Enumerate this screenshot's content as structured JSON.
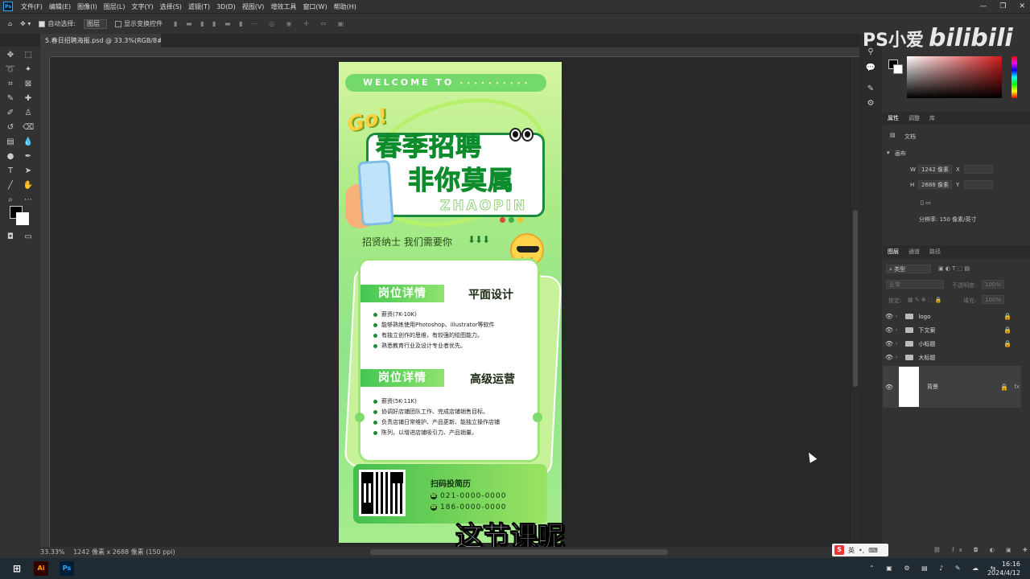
{
  "menu": {
    "items": [
      "文件(F)",
      "编辑(E)",
      "图像(I)",
      "图层(L)",
      "文字(Y)",
      "选择(S)",
      "滤镜(T)",
      "3D(D)",
      "视图(V)",
      "增效工具",
      "窗口(W)",
      "帮助(H)"
    ]
  },
  "options": {
    "auto_select_label": "自动选择:",
    "auto_select_value": "图层",
    "show_transform_label": "显示变换控件"
  },
  "document": {
    "tab_title": "5.春日招聘海报.psd @ 33.3%(RGB/8#) *",
    "zoom": "33.33%",
    "size_info": "1242 像素 x 2688 像素 (150 ppi)"
  },
  "poster": {
    "welcome": "WELCOME TO",
    "welcome_dots": "• • • • • • • • • •",
    "go": "Go!",
    "title_line1": "春季招聘",
    "title_line2": "非你莫属",
    "zhaopin": "ZHAOPIN",
    "subtitle": "招贤纳士 我们需要你",
    "arrows": "⬇⬇⬇",
    "section1": {
      "label": "岗位详情",
      "role": "平面设计",
      "bullets": [
        "薪资(7K-10K)",
        "能够熟练使用Photoshop、illustrator等软件",
        "有独立创作的思维，有较强的绘图能力。",
        "熟悉教育行业及设计专业者优先。"
      ]
    },
    "section2": {
      "label": "岗位详情",
      "role": "高级运营",
      "bullets": [
        "薪资(5K-11K)",
        "协调好店铺团队工作、完成店铺销售目标。",
        "负责店铺日常维护、产品更新、能独立操作店铺",
        "陈列，以增进店铺吸引力、产品销量。"
      ]
    },
    "scan_label": "扫码投简历",
    "phone1": "021-0000-0000",
    "phone2": "186-0000-0000",
    "dot_colors": [
      "#d94a3a",
      "#3fae47",
      "#f2c230"
    ]
  },
  "caption": "这节课呢",
  "watermark": {
    "ps": "PS小爱",
    "brand": "bilibili"
  },
  "panels": {
    "properties_tabs": [
      "属性",
      "调整",
      "库"
    ],
    "doc_label": "文档",
    "canvas_label": "画布",
    "width_label": "W",
    "width_value": "1242 像素",
    "height_label": "H",
    "height_value": "2688 像素",
    "x_label": "X",
    "y_label": "Y",
    "resolution": "分辨率: 150 像素/英寸",
    "layer_tabs": [
      "图层",
      "通道",
      "路径"
    ],
    "layer_filter": "类型",
    "blend_mode": "正常",
    "opacity_label": "不透明度:",
    "opacity_value": "100%",
    "lock_label": "锁定:",
    "fill_label": "填充:",
    "fill_value": "100%",
    "layers": [
      "logo",
      "下文案",
      "小标题",
      "大标题"
    ],
    "background_layer": "背景"
  },
  "ime": {
    "lang": "英",
    "dot": "•,"
  },
  "taskbar": {
    "time": "16:16",
    "date": "2024/4/12",
    "apps": [
      "Ai",
      "Ps"
    ]
  }
}
